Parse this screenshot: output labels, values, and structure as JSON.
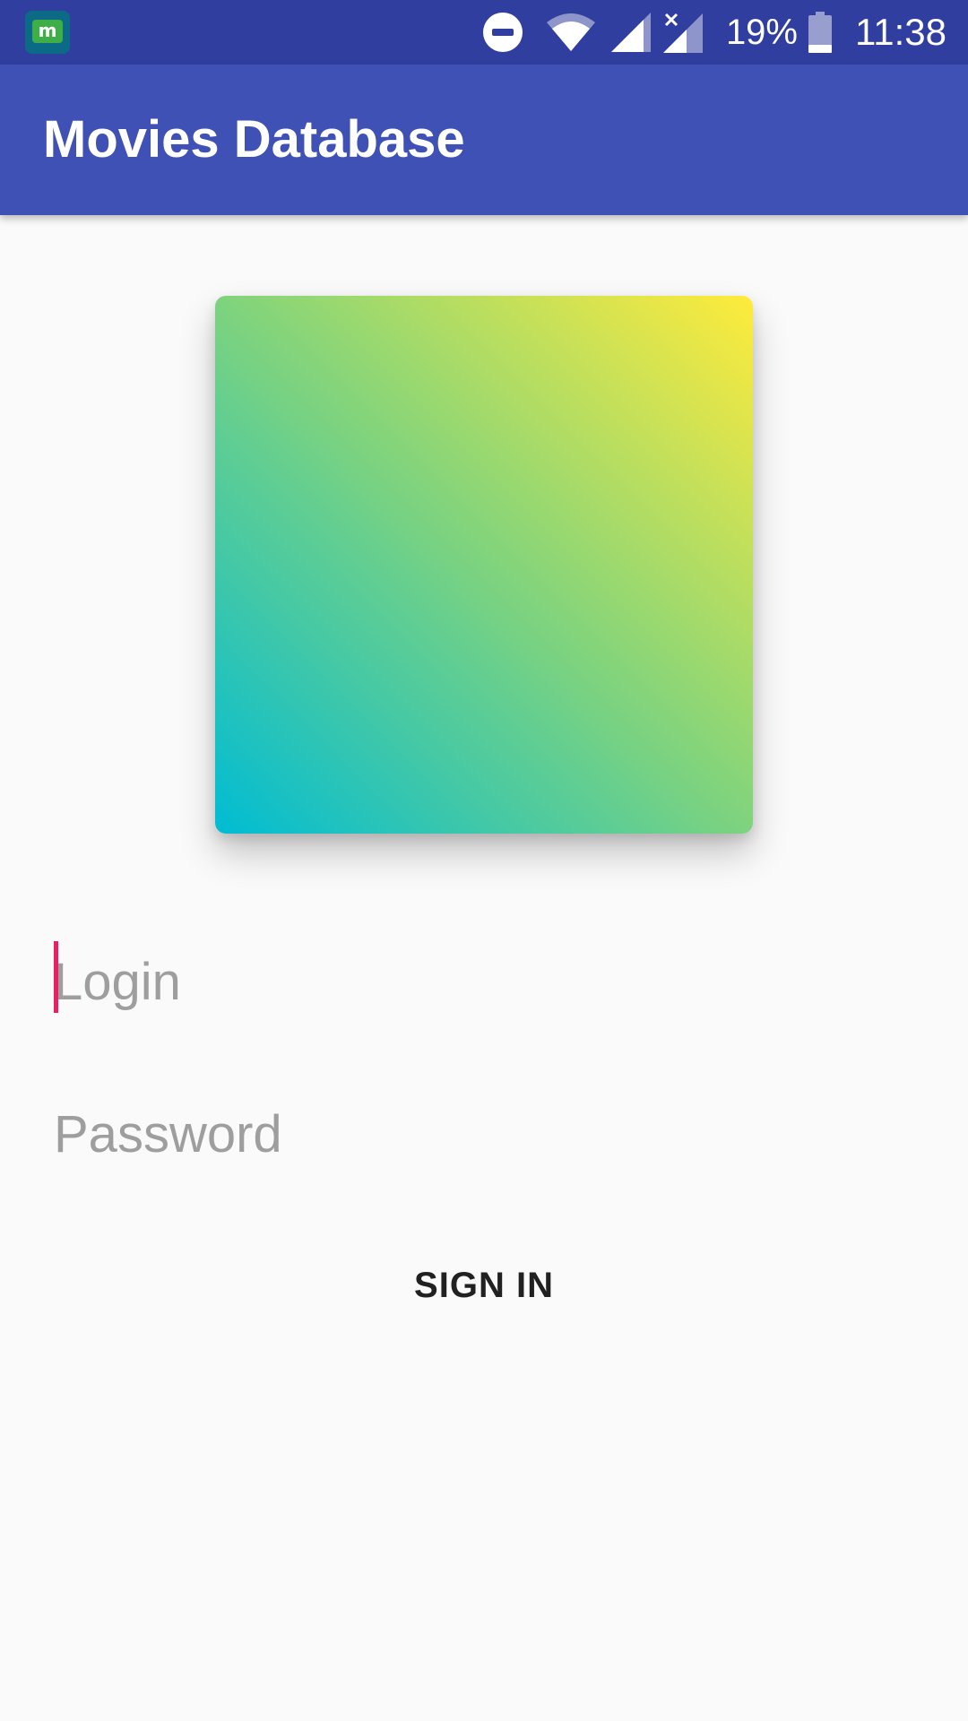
{
  "status_bar": {
    "icons": [
      "app-notification-icon",
      "do-not-disturb-icon",
      "wifi-icon",
      "cell-signal-icon",
      "cell-signal-no-data-icon",
      "battery-icon"
    ],
    "battery_percent": "19%",
    "time": "11:38",
    "app_notification_letter": "m"
  },
  "app_bar": {
    "title": "Movies Database",
    "color": "#3f51b5",
    "status_bar_color": "#303f9f"
  },
  "poster": {
    "gradient_colors": [
      "#00bcd4",
      "#7ed37e",
      "#ffeb3b"
    ]
  },
  "form": {
    "login_placeholder": "Login",
    "login_value": "",
    "password_placeholder": "Password",
    "password_value": "",
    "cursor_color": "#e91e63",
    "sign_in_label": "SIGN IN"
  }
}
